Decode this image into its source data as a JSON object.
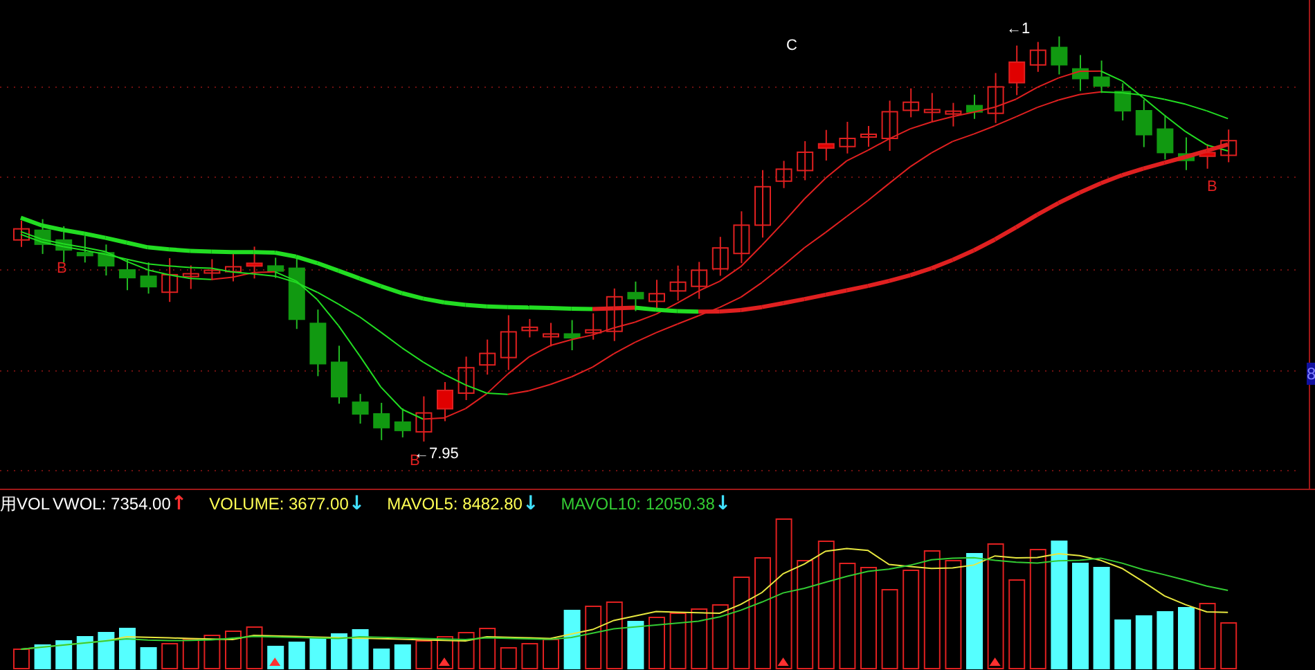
{
  "price_panel": {
    "markers": [
      {
        "text": "C",
        "color": "#ffffff"
      },
      {
        "text": "←1",
        "color": "#ffffff"
      },
      {
        "text": "B",
        "color": "#e02020"
      },
      {
        "text": "B",
        "color": "#e02020"
      },
      {
        "text": "B",
        "color": "#e02020"
      },
      {
        "text": "←7.95",
        "color": "#ffffff"
      }
    ],
    "axis_label": "8"
  },
  "volume_panel": {
    "legend": [
      {
        "text": "用VOL",
        "color": "#ffffff"
      },
      {
        "text": "VWOL: 7354.00",
        "color": "#ffffff",
        "arrow": {
          "text": "↑",
          "color": "#ff3030"
        }
      },
      {
        "text": "VOLUME: 3677.00",
        "color": "#ffff54",
        "arrow": {
          "text": "↓",
          "color": "#40e0ff"
        }
      },
      {
        "text": "MAVOL5: 8482.80",
        "color": "#ffff54",
        "arrow": {
          "text": "↓",
          "color": "#40e0ff"
        }
      },
      {
        "text": "MAVOL10: 12050.38",
        "color": "#33cc33",
        "arrow": {
          "text": "↓",
          "color": "#40e0ff"
        }
      }
    ]
  }
}
